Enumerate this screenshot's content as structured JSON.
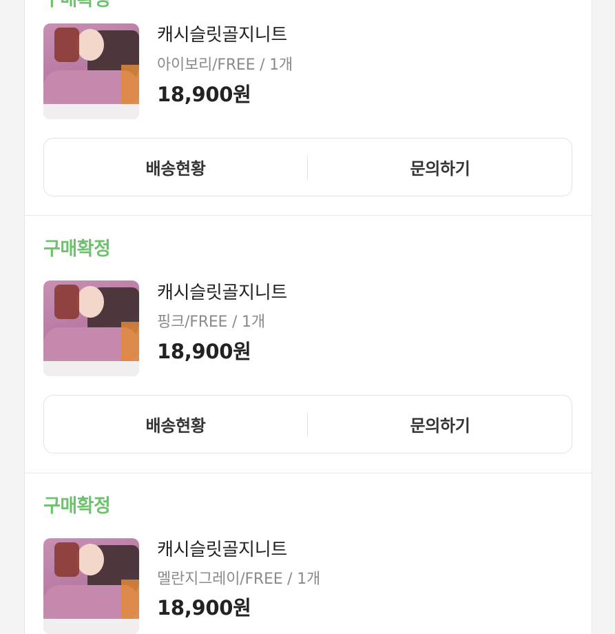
{
  "orders": [
    {
      "status": "구매확정",
      "product": {
        "name": "캐시슬릿골지니트",
        "option": "아이보리/FREE / 1개",
        "price": "18,900원",
        "image": "product-thumbnail-sweater"
      },
      "buttons": {
        "left": "배송현황",
        "right": "문의하기"
      }
    },
    {
      "status": "구매확정",
      "product": {
        "name": "캐시슬릿골지니트",
        "option": "핑크/FREE / 1개",
        "price": "18,900원",
        "image": "product-thumbnail-sweater"
      },
      "buttons": {
        "left": "배송현황",
        "right": "문의하기"
      }
    },
    {
      "status": "구매확정",
      "product": {
        "name": "캐시슬릿골지니트",
        "option": "멜란지그레이/FREE / 1개",
        "price": "18,900원",
        "image": "product-thumbnail-sweater"
      }
    }
  ],
  "colors": {
    "status_green": "#6cc36c",
    "text_dark": "#222222",
    "text_gray": "#8a8a8e",
    "border": "#e2e2e4"
  }
}
